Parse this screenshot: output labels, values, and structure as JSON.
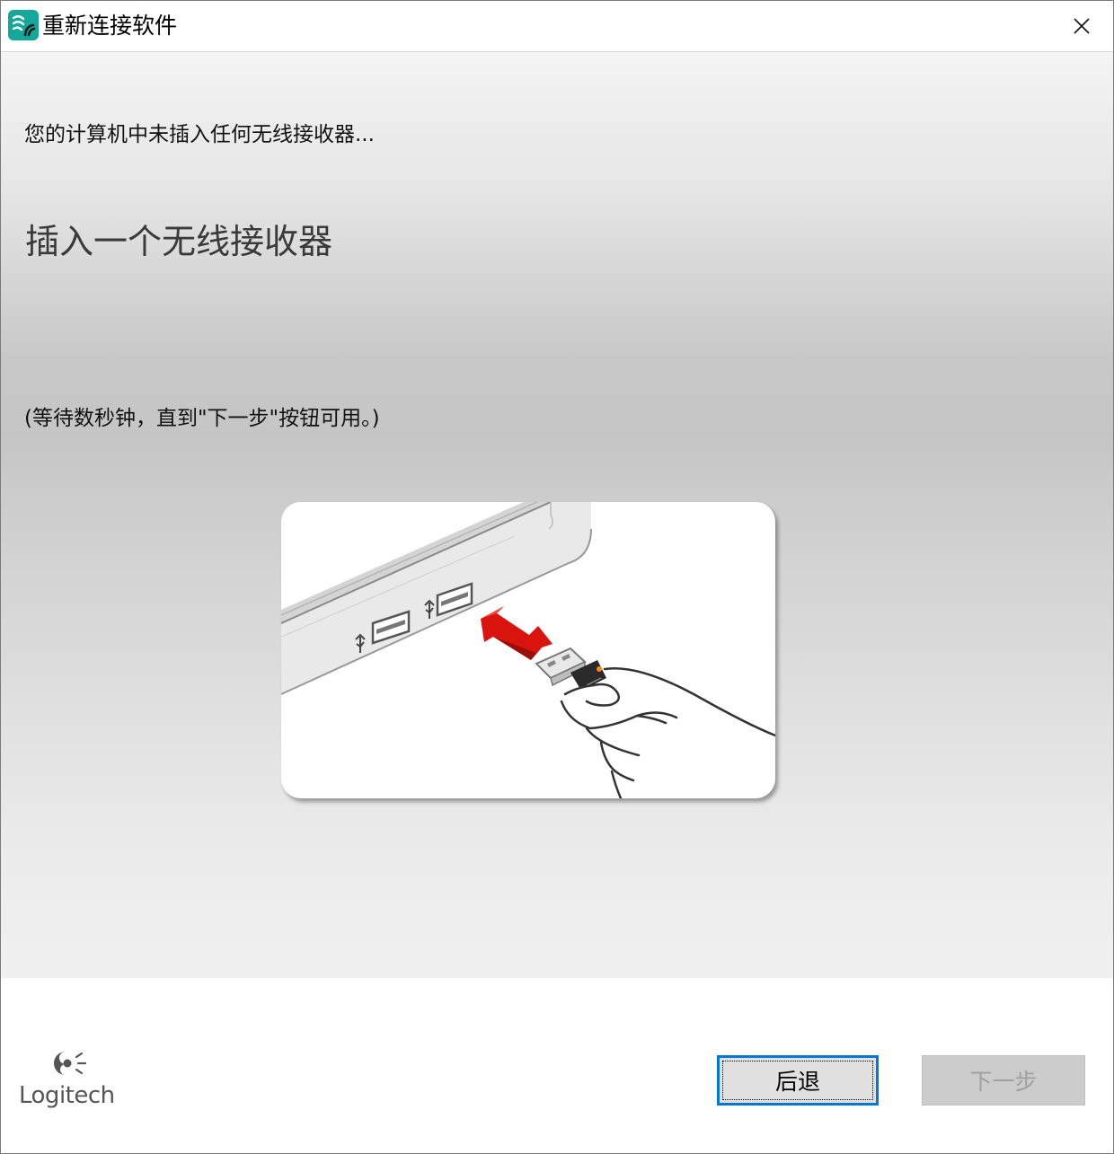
{
  "window": {
    "title": "重新连接软件",
    "app_icon": "logitech-connect-icon",
    "close_icon": "close-icon"
  },
  "main": {
    "status_text": "您的计算机中未插入任何无线接收器...",
    "heading": "插入一个无线接收器",
    "wait_text": "(等待数秒钟，直到\"下一步\"按钮可用。)",
    "illustration": "usb-receiver-insert-illustration"
  },
  "footer": {
    "logo_text": "Logitech",
    "back_label": "后退",
    "next_label": "下一步",
    "next_enabled": false
  },
  "colors": {
    "accent": "#0078d7",
    "app_icon_bg": "#13a89a",
    "arrow": "#d9140f"
  }
}
